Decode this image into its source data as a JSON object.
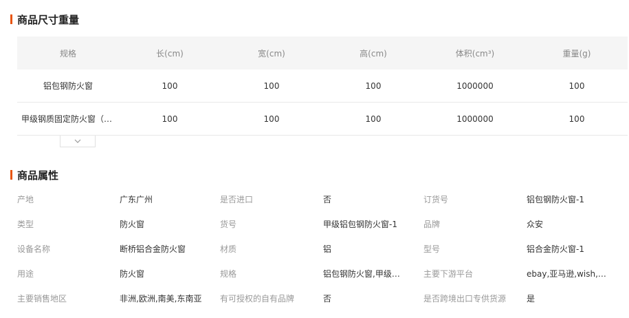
{
  "size_section": {
    "title": "商品尺寸重量",
    "headers": [
      "规格",
      "长(cm)",
      "宽(cm)",
      "高(cm)",
      "体积(cm³)",
      "重量(g)"
    ],
    "rows": [
      [
        "铝包钢防火窗",
        "100",
        "100",
        "100",
        "1000000",
        "100"
      ],
      [
        "甲级钢质固定防火窗（钢质固定防火窗）",
        "100",
        "100",
        "100",
        "1000000",
        "100"
      ]
    ],
    "expand_icon": "chevron-down-icon"
  },
  "attr_section": {
    "title": "商品属性",
    "rows": [
      [
        [
          "产地",
          "广东广州"
        ],
        [
          "是否进口",
          "否"
        ],
        [
          "订货号",
          "铝包钢防火窗-1"
        ]
      ],
      [
        [
          "类型",
          "防火窗"
        ],
        [
          "货号",
          "甲级铝包钢防火窗-1"
        ],
        [
          "品牌",
          "众安"
        ]
      ],
      [
        [
          "设备名称",
          "断桥铝合金防火窗"
        ],
        [
          "材质",
          "铝"
        ],
        [
          "型号",
          "铝合金防火窗-1"
        ]
      ],
      [
        [
          "用途",
          "防火窗"
        ],
        [
          "规格",
          "铝包钢防火窗,甲级钢质固定防火窗"
        ],
        [
          "主要下游平台",
          "ebay,亚马逊,wish,速卖通"
        ]
      ],
      [
        [
          "主要销售地区",
          "非洲,欧洲,南美,东南亚"
        ],
        [
          "有可授权的自有品牌",
          "否"
        ],
        [
          "是否跨境出口专供货源",
          "是"
        ]
      ]
    ]
  },
  "colors": {
    "accent": "#e8540c",
    "header_bg": "#f5f5f5",
    "label": "#999999",
    "text": "#333333"
  }
}
